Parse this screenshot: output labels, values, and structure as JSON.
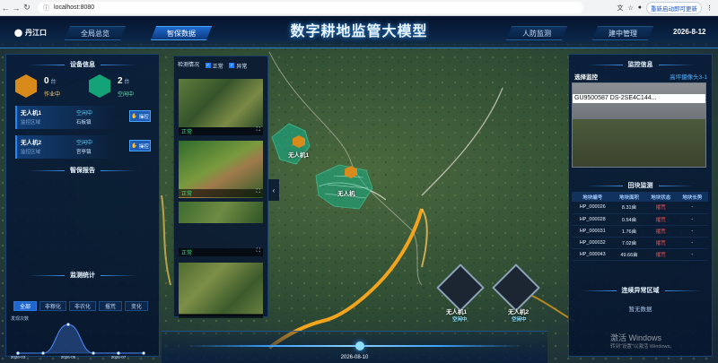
{
  "browser": {
    "url": "localhost:8080",
    "update_button": "重新启动即可更新"
  },
  "header": {
    "location": "丹江口",
    "title": "数字耕地监管大模型",
    "date": "2026-8-12",
    "nav": [
      "全局总览",
      "智保数据",
      "人防监测",
      "建中管理"
    ],
    "active_nav": "智保数据"
  },
  "left": {
    "device_title": "设备信息",
    "working": {
      "count": "0",
      "unit": "台",
      "label": "作业中"
    },
    "idle": {
      "count": "2",
      "unit": "台",
      "label": "空闲中"
    },
    "uavs": [
      {
        "name": "无人机1",
        "status": "空闲中",
        "sub": "监控区域",
        "value": "石板镇",
        "btn": "操控"
      },
      {
        "name": "无人机2",
        "status": "空闲中",
        "sub": "监控区域",
        "value": "官亭镇",
        "btn": "操控"
      }
    ],
    "alert_title": "智保报告",
    "stats_title": "监测统计",
    "tabs": [
      "全部",
      "非粮化",
      "非农化",
      "撂荒",
      "变化"
    ],
    "active_tab": "全部",
    "chart_caption": "发现次数"
  },
  "chart_data": {
    "type": "line",
    "title": "",
    "ylabel": "发现次数",
    "x": [
      "2026-03",
      "2026-04",
      "2026-05",
      "2026-06",
      "2026-07",
      "2026-08"
    ],
    "categories_printed": [
      "2026-03",
      "2026-05",
      "2026-07"
    ],
    "values": [
      0,
      0,
      1,
      0,
      0,
      0
    ],
    "ylim": [
      0,
      1
    ],
    "grid": false,
    "series_color": "#4f8dff"
  },
  "image_panel": {
    "title": "检测情况",
    "filters": [
      "正常",
      "异常"
    ],
    "thumbs": [
      {
        "status": "正常"
      },
      {
        "status": "正常"
      },
      {
        "status": ""
      },
      {
        "status": "正常"
      },
      {
        "status": ""
      }
    ]
  },
  "map": {
    "uav1_label": "无人机1",
    "uav2_label": "无人机2",
    "uav_status": "空闲中",
    "drone_marker1": "无人机1",
    "drone_marker2": "无人机"
  },
  "right": {
    "monitor_title": "监控信息",
    "select_label": "选择监控",
    "camera_select": "高坪摄像头3-1",
    "camera_id": "GU9500587 DS-2SE4C144...",
    "plots_title": "田块监测",
    "columns": [
      "地块编号",
      "地块面积",
      "地块状态",
      "地块长势"
    ],
    "rows": [
      [
        "HP_000026",
        "8.31亩",
        "撂荒",
        "-"
      ],
      [
        "HP_000028",
        "0.54亩",
        "撂荒",
        "-"
      ],
      [
        "HP_000031",
        "1.76亩",
        "撂荒",
        "-"
      ],
      [
        "HP_000032",
        "7.02亩",
        "撂荒",
        "-"
      ],
      [
        "HP_000043",
        "49.66亩",
        "撂荒",
        "-"
      ]
    ],
    "abnormal_title": "连续异常区域",
    "no_data": "暂无数据"
  },
  "timeline": {
    "date": "2026-08-10"
  },
  "watermark": {
    "line1": "激活 Windows",
    "line2": "转到\"设置\"以激活 Windows。"
  },
  "colors": {
    "accent": "#1f7dff",
    "alert": "#ff4d4d",
    "ok": "#37e07a",
    "teal": "#14b48c",
    "amber": "#d88a1a"
  }
}
